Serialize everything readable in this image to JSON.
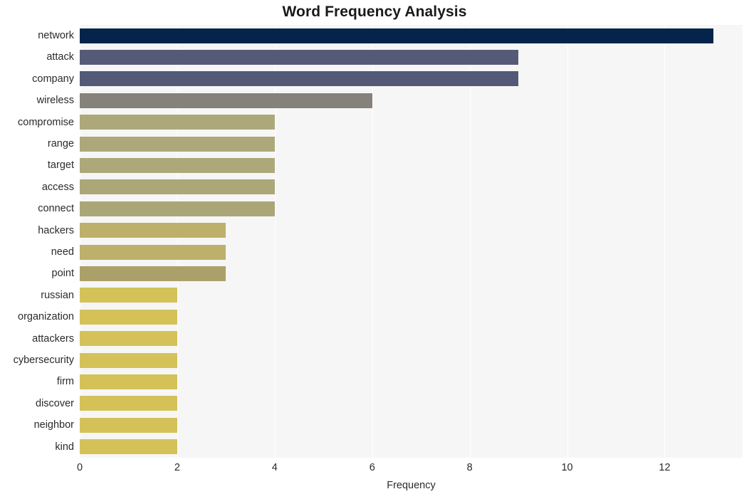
{
  "chart_data": {
    "type": "bar",
    "orientation": "horizontal",
    "title": "Word Frequency Analysis",
    "xlabel": "Frequency",
    "ylabel": "",
    "xlim": [
      0,
      13.6
    ],
    "ylim": [
      0,
      20
    ],
    "grid": true,
    "legend": false,
    "xticks": [
      0,
      2,
      4,
      6,
      8,
      10,
      12
    ],
    "xtick_labels": [
      "0",
      "2",
      "4",
      "6",
      "8",
      "10",
      "12"
    ],
    "categories": [
      "network",
      "attack",
      "company",
      "wireless",
      "compromise",
      "range",
      "target",
      "access",
      "connect",
      "hackers",
      "need",
      "point",
      "russian",
      "organization",
      "attackers",
      "cybersecurity",
      "firm",
      "discover",
      "neighbor",
      "kind"
    ],
    "values": [
      13,
      9,
      9,
      6,
      4,
      4,
      4,
      4,
      4,
      3,
      3,
      3,
      2,
      2,
      2,
      2,
      2,
      2,
      2,
      2
    ],
    "bar_colors": [
      "#04244b",
      "#555b77",
      "#535977",
      "#84827b",
      "#ada островок",
      "#ada87a",
      "#ada87a",
      "#aca779",
      "#aba677",
      "#bcb06b",
      "#bcb06b",
      "#aca06a",
      "#d4c259",
      "#d4c259",
      "#d4c259",
      "#d4c259",
      "#d4c259",
      "#d4c259",
      "#d4c259",
      "#d4c259"
    ],
    "plot_background": "#f6f6f6",
    "gridline_color": "#ffffff",
    "figure_background": "#ffffff",
    "text_color": "#2b2b2b",
    "title_color": "#1a1a1a"
  }
}
